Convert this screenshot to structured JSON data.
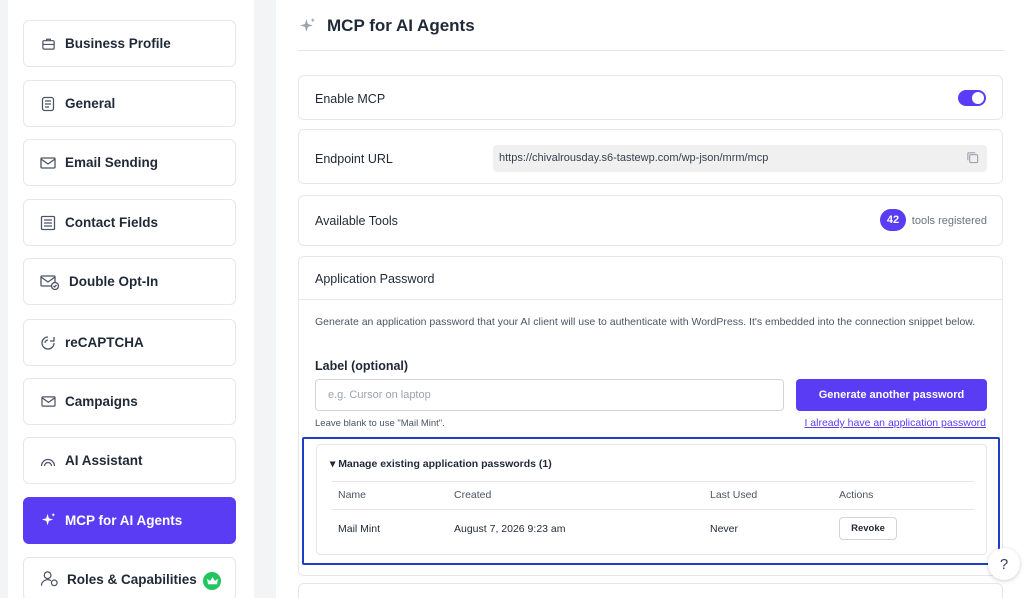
{
  "sidebar": {
    "items": [
      {
        "label": "Business Profile",
        "icon": "briefcase-icon"
      },
      {
        "label": "General",
        "icon": "document-icon"
      },
      {
        "label": "Email Sending",
        "icon": "envelope-icon"
      },
      {
        "label": "Contact Fields",
        "icon": "form-fields-icon"
      },
      {
        "label": "Double Opt-In",
        "icon": "mail-check-icon"
      },
      {
        "label": "reCAPTCHA",
        "icon": "recaptcha-icon"
      },
      {
        "label": "Campaigns",
        "icon": "envelope-icon"
      },
      {
        "label": "AI Assistant",
        "icon": "rainbow-icon"
      },
      {
        "label": "MCP for AI Agents",
        "icon": "sparkle-icon",
        "active": true
      },
      {
        "label": "Roles & Capabilities",
        "icon": "user-gear-icon",
        "badge_icon": "crown-icon"
      }
    ]
  },
  "page": {
    "title": "MCP for AI Agents",
    "title_icon": "sparkle-icon"
  },
  "enable_mcp": {
    "label": "Enable MCP",
    "enabled": true
  },
  "endpoint": {
    "label": "Endpoint URL",
    "url": "https://chivalrousday.s6-tastewp.com/wp-json/mrm/mcp"
  },
  "tools": {
    "label": "Available Tools",
    "count": "42",
    "suffix": "tools registered"
  },
  "app_password": {
    "title": "Application Password",
    "description": "Generate an application password that your AI client will use to authenticate with WordPress. It's embedded into the connection snippet below.",
    "field_label": "Label (optional)",
    "placeholder": "e.g. Cursor on laptop",
    "value": "",
    "generate_button": "Generate another password",
    "hint": "Leave blank to use \"Mail Mint\".",
    "existing_link": "I already have an application password",
    "manage": {
      "summary": "▾ Manage existing application passwords (1)",
      "columns": [
        "Name",
        "Created",
        "Last Used",
        "Actions"
      ],
      "rows": [
        {
          "name": "Mail Mint",
          "created": "August 7, 2026 9:23 am",
          "last_used": "Never",
          "action": "Revoke"
        }
      ]
    }
  },
  "help": {
    "label": "?"
  },
  "colors": {
    "accent": "#5b3cf5",
    "highlight_border": "#1d3fc4",
    "crown_badge": "#22c55e"
  }
}
